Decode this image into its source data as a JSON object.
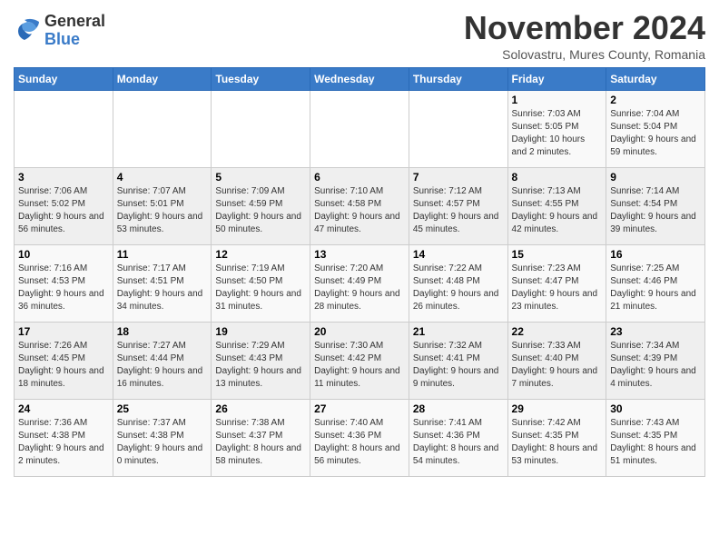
{
  "logo": {
    "general": "General",
    "blue": "Blue"
  },
  "title": "November 2024",
  "location": "Solovastru, Mures County, Romania",
  "days_of_week": [
    "Sunday",
    "Monday",
    "Tuesday",
    "Wednesday",
    "Thursday",
    "Friday",
    "Saturday"
  ],
  "weeks": [
    [
      {
        "day": "",
        "sunrise": "",
        "sunset": "",
        "daylight": ""
      },
      {
        "day": "",
        "sunrise": "",
        "sunset": "",
        "daylight": ""
      },
      {
        "day": "",
        "sunrise": "",
        "sunset": "",
        "daylight": ""
      },
      {
        "day": "",
        "sunrise": "",
        "sunset": "",
        "daylight": ""
      },
      {
        "day": "",
        "sunrise": "",
        "sunset": "",
        "daylight": ""
      },
      {
        "day": "1",
        "sunrise": "Sunrise: 7:03 AM",
        "sunset": "Sunset: 5:05 PM",
        "daylight": "Daylight: 10 hours and 2 minutes."
      },
      {
        "day": "2",
        "sunrise": "Sunrise: 7:04 AM",
        "sunset": "Sunset: 5:04 PM",
        "daylight": "Daylight: 9 hours and 59 minutes."
      }
    ],
    [
      {
        "day": "3",
        "sunrise": "Sunrise: 7:06 AM",
        "sunset": "Sunset: 5:02 PM",
        "daylight": "Daylight: 9 hours and 56 minutes."
      },
      {
        "day": "4",
        "sunrise": "Sunrise: 7:07 AM",
        "sunset": "Sunset: 5:01 PM",
        "daylight": "Daylight: 9 hours and 53 minutes."
      },
      {
        "day": "5",
        "sunrise": "Sunrise: 7:09 AM",
        "sunset": "Sunset: 4:59 PM",
        "daylight": "Daylight: 9 hours and 50 minutes."
      },
      {
        "day": "6",
        "sunrise": "Sunrise: 7:10 AM",
        "sunset": "Sunset: 4:58 PM",
        "daylight": "Daylight: 9 hours and 47 minutes."
      },
      {
        "day": "7",
        "sunrise": "Sunrise: 7:12 AM",
        "sunset": "Sunset: 4:57 PM",
        "daylight": "Daylight: 9 hours and 45 minutes."
      },
      {
        "day": "8",
        "sunrise": "Sunrise: 7:13 AM",
        "sunset": "Sunset: 4:55 PM",
        "daylight": "Daylight: 9 hours and 42 minutes."
      },
      {
        "day": "9",
        "sunrise": "Sunrise: 7:14 AM",
        "sunset": "Sunset: 4:54 PM",
        "daylight": "Daylight: 9 hours and 39 minutes."
      }
    ],
    [
      {
        "day": "10",
        "sunrise": "Sunrise: 7:16 AM",
        "sunset": "Sunset: 4:53 PM",
        "daylight": "Daylight: 9 hours and 36 minutes."
      },
      {
        "day": "11",
        "sunrise": "Sunrise: 7:17 AM",
        "sunset": "Sunset: 4:51 PM",
        "daylight": "Daylight: 9 hours and 34 minutes."
      },
      {
        "day": "12",
        "sunrise": "Sunrise: 7:19 AM",
        "sunset": "Sunset: 4:50 PM",
        "daylight": "Daylight: 9 hours and 31 minutes."
      },
      {
        "day": "13",
        "sunrise": "Sunrise: 7:20 AM",
        "sunset": "Sunset: 4:49 PM",
        "daylight": "Daylight: 9 hours and 28 minutes."
      },
      {
        "day": "14",
        "sunrise": "Sunrise: 7:22 AM",
        "sunset": "Sunset: 4:48 PM",
        "daylight": "Daylight: 9 hours and 26 minutes."
      },
      {
        "day": "15",
        "sunrise": "Sunrise: 7:23 AM",
        "sunset": "Sunset: 4:47 PM",
        "daylight": "Daylight: 9 hours and 23 minutes."
      },
      {
        "day": "16",
        "sunrise": "Sunrise: 7:25 AM",
        "sunset": "Sunset: 4:46 PM",
        "daylight": "Daylight: 9 hours and 21 minutes."
      }
    ],
    [
      {
        "day": "17",
        "sunrise": "Sunrise: 7:26 AM",
        "sunset": "Sunset: 4:45 PM",
        "daylight": "Daylight: 9 hours and 18 minutes."
      },
      {
        "day": "18",
        "sunrise": "Sunrise: 7:27 AM",
        "sunset": "Sunset: 4:44 PM",
        "daylight": "Daylight: 9 hours and 16 minutes."
      },
      {
        "day": "19",
        "sunrise": "Sunrise: 7:29 AM",
        "sunset": "Sunset: 4:43 PM",
        "daylight": "Daylight: 9 hours and 13 minutes."
      },
      {
        "day": "20",
        "sunrise": "Sunrise: 7:30 AM",
        "sunset": "Sunset: 4:42 PM",
        "daylight": "Daylight: 9 hours and 11 minutes."
      },
      {
        "day": "21",
        "sunrise": "Sunrise: 7:32 AM",
        "sunset": "Sunset: 4:41 PM",
        "daylight": "Daylight: 9 hours and 9 minutes."
      },
      {
        "day": "22",
        "sunrise": "Sunrise: 7:33 AM",
        "sunset": "Sunset: 4:40 PM",
        "daylight": "Daylight: 9 hours and 7 minutes."
      },
      {
        "day": "23",
        "sunrise": "Sunrise: 7:34 AM",
        "sunset": "Sunset: 4:39 PM",
        "daylight": "Daylight: 9 hours and 4 minutes."
      }
    ],
    [
      {
        "day": "24",
        "sunrise": "Sunrise: 7:36 AM",
        "sunset": "Sunset: 4:38 PM",
        "daylight": "Daylight: 9 hours and 2 minutes."
      },
      {
        "day": "25",
        "sunrise": "Sunrise: 7:37 AM",
        "sunset": "Sunset: 4:38 PM",
        "daylight": "Daylight: 9 hours and 0 minutes."
      },
      {
        "day": "26",
        "sunrise": "Sunrise: 7:38 AM",
        "sunset": "Sunset: 4:37 PM",
        "daylight": "Daylight: 8 hours and 58 minutes."
      },
      {
        "day": "27",
        "sunrise": "Sunrise: 7:40 AM",
        "sunset": "Sunset: 4:36 PM",
        "daylight": "Daylight: 8 hours and 56 minutes."
      },
      {
        "day": "28",
        "sunrise": "Sunrise: 7:41 AM",
        "sunset": "Sunset: 4:36 PM",
        "daylight": "Daylight: 8 hours and 54 minutes."
      },
      {
        "day": "29",
        "sunrise": "Sunrise: 7:42 AM",
        "sunset": "Sunset: 4:35 PM",
        "daylight": "Daylight: 8 hours and 53 minutes."
      },
      {
        "day": "30",
        "sunrise": "Sunrise: 7:43 AM",
        "sunset": "Sunset: 4:35 PM",
        "daylight": "Daylight: 8 hours and 51 minutes."
      }
    ]
  ]
}
